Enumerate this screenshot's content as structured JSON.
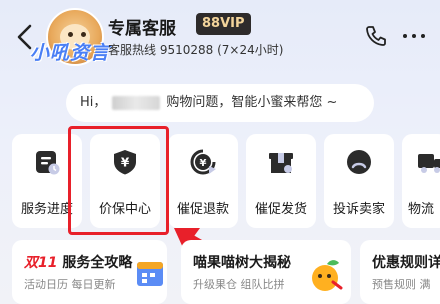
{
  "header": {
    "title": "专属客服",
    "vip_badge": "88VIP",
    "hotline": "客服热线 9510288 (7×24小时)",
    "watermark": "小吼资言"
  },
  "greeting": {
    "prefix": "Hi，",
    "suffix": "购物问题，智能小蜜来帮您 ~"
  },
  "services": [
    {
      "label": "服务进度",
      "icon": "service-progress-icon"
    },
    {
      "label": "价保中心",
      "icon": "price-protection-shield-icon"
    },
    {
      "label": "催促退款",
      "icon": "refund-coin-icon"
    },
    {
      "label": "催促发货",
      "icon": "shipping-box-icon"
    },
    {
      "label": "投诉卖家",
      "icon": "complaint-face-icon"
    },
    {
      "label": "物流",
      "icon": "logistics-truck-icon"
    }
  ],
  "cards": [
    {
      "title_highlight": "双11",
      "title": "服务全攻略",
      "sub": "活动日历 每日更新"
    },
    {
      "title": "喵果喵树大揭秘",
      "sub": "升级果仓 组队比拼"
    },
    {
      "title": "优惠规则详",
      "sub": "预售规则 满"
    }
  ],
  "colors": {
    "accent_red": "#e8202a",
    "vip_bg": "#2e2b2b",
    "vip_text": "#f3d49b",
    "watermark": "#4a7ff5"
  }
}
